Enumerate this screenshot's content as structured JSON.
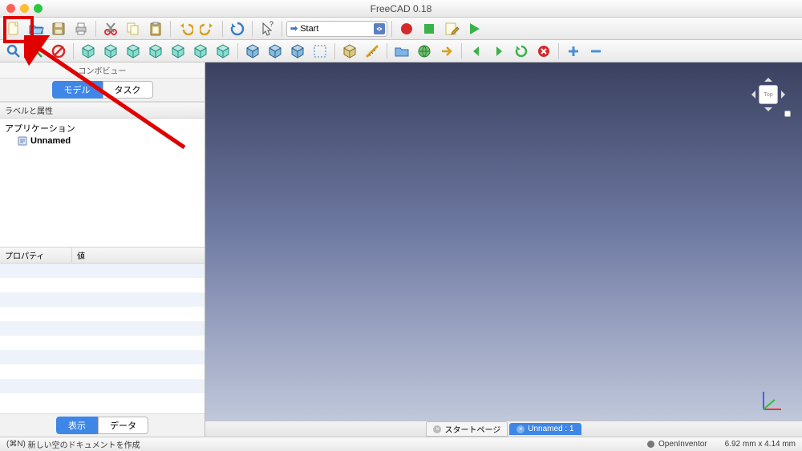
{
  "title": "FreeCAD 0.18",
  "workbench": {
    "label": "Start"
  },
  "panel": {
    "title": "コンボビュー",
    "top_tabs": [
      "モデル",
      "タスク"
    ],
    "active_top_tab": 0,
    "section_label": "ラベルと属性",
    "tree": {
      "root": "アプリケーション",
      "doc": "Unnamed"
    },
    "prop_headers": [
      "プロパティ",
      "値"
    ],
    "bottom_tabs": [
      "表示",
      "データ"
    ],
    "active_bottom_tab": 0
  },
  "navcube": {
    "face": "Top"
  },
  "viewport_tabs": [
    {
      "label": "スタートページ",
      "active": false
    },
    {
      "label": "Unnamed : 1",
      "active": true
    }
  ],
  "status": {
    "left_shortcut": "(⌘N)",
    "left_text": "新しい空のドキュメントを作成",
    "renderer": "OpenInventor",
    "dims": "6.92 mm x 4.14 mm"
  },
  "icons": {
    "toolbar1": [
      "new-file",
      "open-file",
      "save-file",
      "print",
      "sep",
      "cut",
      "copy",
      "paste",
      "sep",
      "undo",
      "redo",
      "sep",
      "refresh",
      "sep",
      "pointer",
      "sep",
      "workbench",
      "sep",
      "record",
      "stop",
      "macro-edit",
      "play"
    ],
    "toolbar2": [
      "fit-all",
      "fit-selection",
      "no-entry",
      "sep",
      "iso-view",
      "front-view",
      "top-view",
      "right-view",
      "back-view",
      "bottom-view",
      "left-view",
      "sep",
      "box-1",
      "box-2",
      "box-3",
      "select-box",
      "sep",
      "part-iso",
      "measure",
      "sep",
      "folder",
      "globe",
      "arrow-right",
      "sep",
      "nav-back",
      "nav-fwd",
      "nav-reload",
      "nav-stop",
      "sep",
      "zoom-in",
      "zoom-out"
    ]
  }
}
